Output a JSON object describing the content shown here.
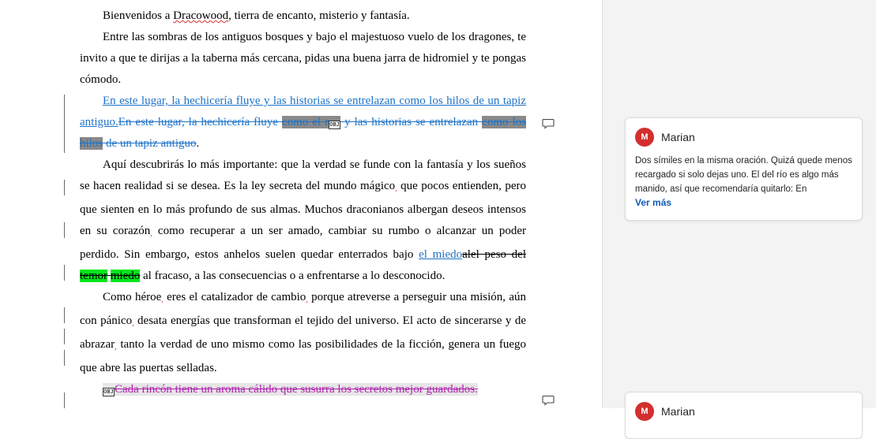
{
  "document": {
    "p1": {
      "before": "Bienvenidos a ",
      "misspelled": "Dracowood",
      "after": ", tierra de encanto, misterio y fantasía."
    },
    "p2": "Entre las sombras de los antiguos bosques y bajo el majestuoso vuelo de los dragones, te invito a que te dirijas a la taberna más cercana, pidas una buena jarra de hidromiel y te pongas cómodo.",
    "p3": {
      "inserted": "En este lugar, la hechicería fluye y las historias se entrelazan como los hilos de un tapiz antiguo.",
      "del1": "En este lugar, la hechicería fluye ",
      "del_hl1": "como el r",
      "del2": " y las historias se entrelazan ",
      "del_hl2": "como los hilos",
      "del3": " de un tapiz antiguo",
      "end": "."
    },
    "p4": {
      "a": "Aquí descubrirás lo más importante: que la verdad se funde con la fantasía y los sueños se hacen realidad si se desea. Es la ley secreta del mundo mágico",
      "b": " que pocos entienden, pero que sienten en lo más profundo de sus almas. Muchos draconianos albergan deseos intensos en su corazón",
      "c": " como recuperar a un ser amado, cambiar su rumbo o alcanzar un poder perdido. Sin embargo, estos anhelos suelen quedar enterrados bajo ",
      "ins": "el miedo",
      "del_a": "al",
      "del_b": "el peso del ",
      "del_hl1": "temor",
      "del_c": " ",
      "del_hl2": "miedo",
      "d": " al fracaso, a las consecuencias o a enfrentarse a lo desconocido."
    },
    "p5": {
      "a": "Como héroe",
      "b": " eres el catalizador de cambio",
      "c": " porque atreverse a perseguir una misión, aún con pánico",
      "d": " desata energías que transforman el tejido del universo. El acto de sincerarse y de abrazar",
      "e": " tanto la verdad de uno mismo como las posibilidades de la ficción, genera un fuego que abre las puertas selladas."
    },
    "p6": {
      "deleted": "Cada rincón tiene un aroma cálido que susurra los secretos mejor guardados."
    },
    "mark_comma": ",",
    "object_glyph": "OBJ"
  },
  "comments": [
    {
      "initial": "M",
      "author": "Marian",
      "text": "Dos símiles en la misma oración. Quizá quede menos recargado si solo dejas uno. El del río es algo más manido, así que recomendaría quitarlo: En",
      "see_more": "Ver más"
    },
    {
      "initial": "M",
      "author": "Marian"
    }
  ],
  "colors": {
    "insertion": "#1f73c7",
    "deletion_purple": "#b022b0",
    "highlight_green": "#00e61c",
    "highlight_gray": "#8a8a8a",
    "avatar": "#d32f2f",
    "link": "#0f5bb5"
  }
}
